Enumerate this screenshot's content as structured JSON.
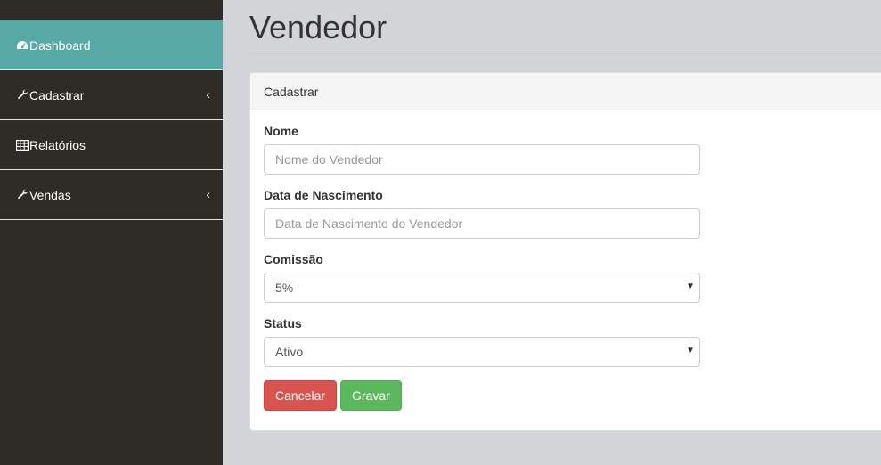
{
  "sidebar": {
    "items": [
      {
        "label": "Dashboard",
        "icon": "dashboard-icon",
        "active": true
      },
      {
        "label": "Cadastrar",
        "icon": "wrench-icon",
        "has_arrow": true
      },
      {
        "label": "Relatórios",
        "icon": "table-icon"
      },
      {
        "label": "Vendas",
        "icon": "wrench-icon",
        "has_arrow": true
      }
    ],
    "arrow_glyph": "‹"
  },
  "page": {
    "title": "Vendedor"
  },
  "panel": {
    "heading": "Cadastrar",
    "fields": {
      "nome": {
        "label": "Nome",
        "placeholder": "Nome do Vendedor"
      },
      "nascimento": {
        "label": "Data de Nascimento",
        "placeholder": "Data de Nascimento do Vendedor"
      },
      "comissao": {
        "label": "Comissão",
        "value": "5%"
      },
      "status": {
        "label": "Status",
        "value": "Ativo"
      }
    },
    "buttons": {
      "cancel": "Cancelar",
      "save": "Gravar"
    }
  },
  "colors": {
    "sidebar_bg": "#2e2c27",
    "active_bg": "#56a9a4",
    "danger": "#d9534f",
    "success": "#5cb85c"
  }
}
